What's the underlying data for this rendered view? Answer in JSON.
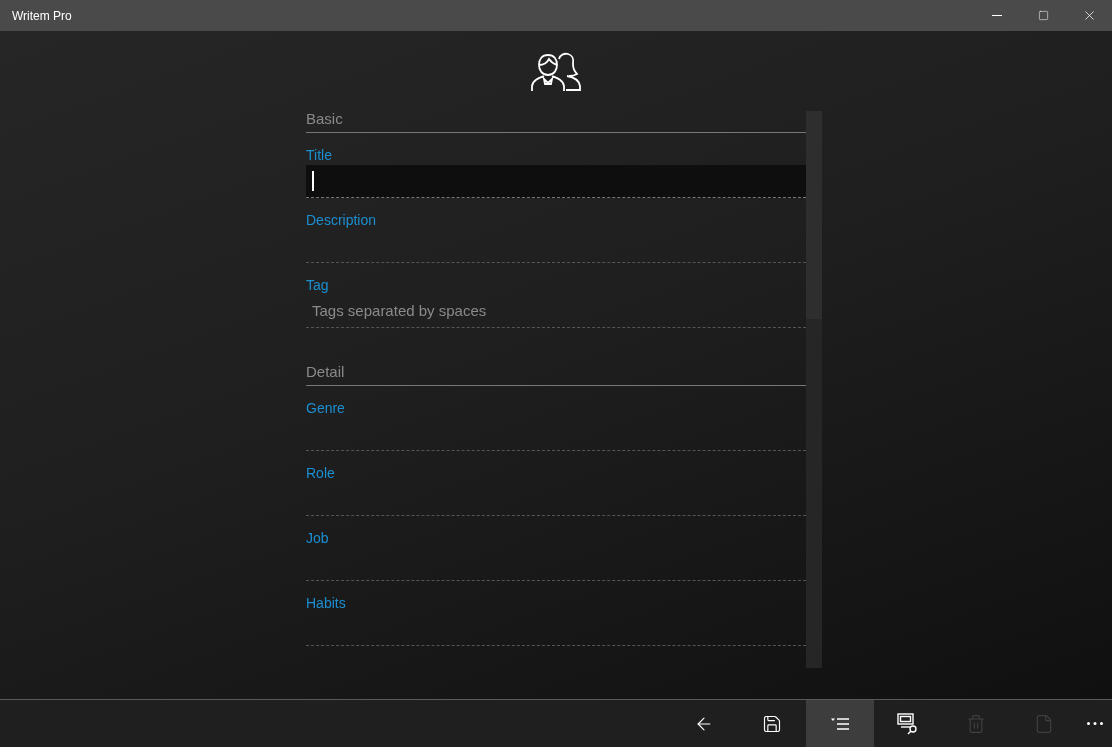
{
  "window": {
    "title": "Writem Pro"
  },
  "sections": [
    {
      "heading": "Basic",
      "fields": [
        {
          "label": "Title",
          "focused": true
        },
        {
          "label": "Description",
          "focused": false
        },
        {
          "label": "Tag",
          "placeholder": "Tags separated by spaces",
          "focused": false
        }
      ]
    },
    {
      "heading": "Detail",
      "fields": [
        {
          "label": "Genre",
          "focused": false
        },
        {
          "label": "Role",
          "focused": false
        },
        {
          "label": "Job",
          "focused": false
        },
        {
          "label": "Habits",
          "focused": false
        }
      ]
    }
  ],
  "toolbar": [
    {
      "kind": "back",
      "selected": false,
      "disabled": false
    },
    {
      "kind": "save",
      "selected": false,
      "disabled": false
    },
    {
      "kind": "outline",
      "selected": true,
      "disabled": false
    },
    {
      "kind": "preview",
      "selected": false,
      "disabled": false
    },
    {
      "kind": "delete",
      "selected": false,
      "disabled": true
    },
    {
      "kind": "document",
      "selected": false,
      "disabled": true
    },
    {
      "kind": "more",
      "selected": false,
      "disabled": false
    }
  ]
}
